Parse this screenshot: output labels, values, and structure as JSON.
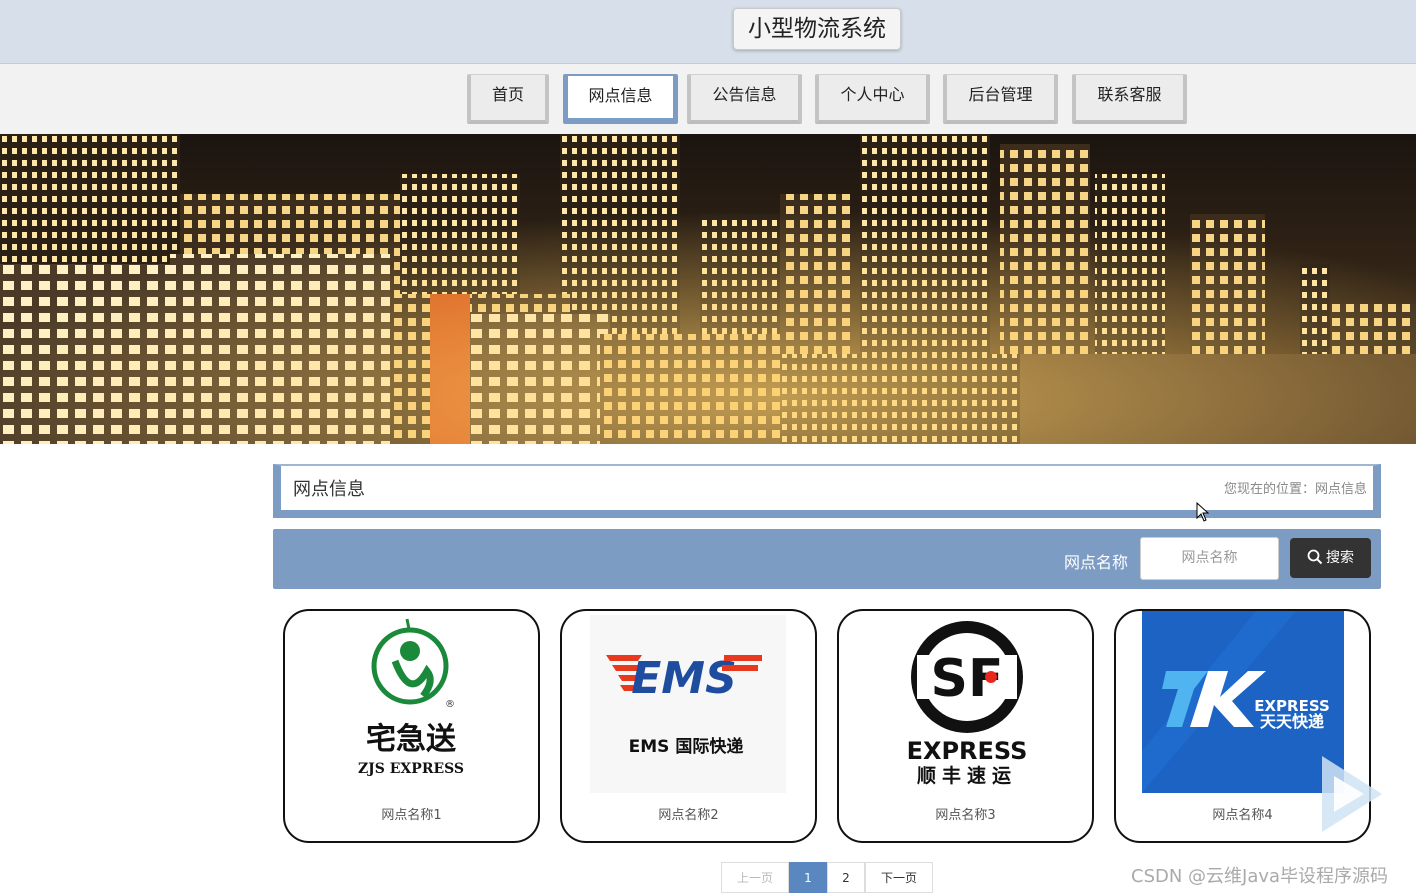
{
  "header": {
    "title": "小型物流系统"
  },
  "nav": {
    "items": [
      {
        "label": "首页",
        "active": false
      },
      {
        "label": "网点信息",
        "active": true
      },
      {
        "label": "公告信息",
        "active": false
      },
      {
        "label": "个人中心",
        "active": false
      },
      {
        "label": "后台管理",
        "active": false
      },
      {
        "label": "联系客服",
        "active": false
      }
    ],
    "active_color": "#7c9cc4"
  },
  "banner": {
    "image": "night city skyline",
    "slides": 3,
    "active_slide": 1
  },
  "section": {
    "title": "网点信息",
    "breadcrumb": "您现在的位置：网点信息"
  },
  "search": {
    "label": "网点名称",
    "placeholder": "网点名称",
    "button_label": "搜索",
    "button_icon": "search-icon"
  },
  "cards": [
    {
      "name": "网点名称1",
      "logo_text_cn": "宅急送",
      "logo_text_en": "ZJS EXPRESS"
    },
    {
      "name": "网点名称2",
      "logo_text_cn": "EMS 国际快递",
      "logo_text_en": "EMS"
    },
    {
      "name": "网点名称3",
      "logo_text_cn": "顺丰速运",
      "logo_text_en": "EXPRESS"
    },
    {
      "name": "网点名称4",
      "logo_text_cn": "天天快递",
      "logo_text_en": "EXPRESS"
    }
  ],
  "pagination": {
    "prev": "上一页",
    "pages": [
      "1",
      "2"
    ],
    "current": "1",
    "next": "下一页"
  },
  "watermark": "CSDN @云维Java毕设程序源码",
  "colors": {
    "accent": "#7c9cc4",
    "header_bg": "#d7e0ea",
    "dark_button": "#333333"
  }
}
